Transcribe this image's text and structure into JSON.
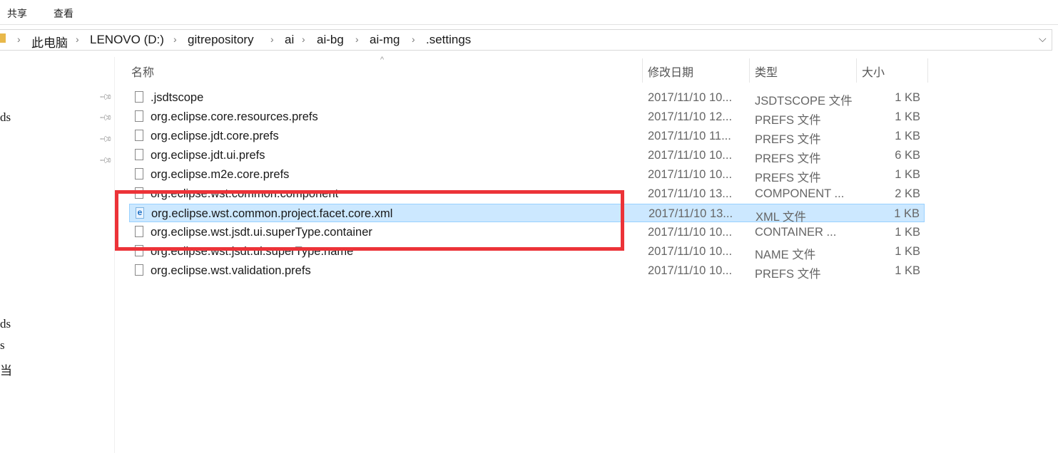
{
  "ribbon": {
    "tabs": [
      "共享",
      "查看"
    ]
  },
  "address_bar": {
    "crumbs": [
      "此电脑",
      "LENOVO (D:)",
      "gitrepository",
      "ai",
      "ai-bg",
      "ai-mg",
      ".settings"
    ]
  },
  "sidebar": {
    "items": [
      "ds",
      "ds",
      "s",
      "当"
    ]
  },
  "columns": {
    "name": "名称",
    "date": "修改日期",
    "type": "类型",
    "size": "大小"
  },
  "files": [
    {
      "name": ".jsdtscope",
      "date": "2017/11/10 10...",
      "type": "JSDTSCOPE 文件",
      "size": "1 KB",
      "icon": "file-icon"
    },
    {
      "name": "org.eclipse.core.resources.prefs",
      "date": "2017/11/10 12...",
      "type": "PREFS 文件",
      "size": "1 KB",
      "icon": "file-icon"
    },
    {
      "name": "org.eclipse.jdt.core.prefs",
      "date": "2017/11/10 11...",
      "type": "PREFS 文件",
      "size": "1 KB",
      "icon": "file-icon"
    },
    {
      "name": "org.eclipse.jdt.ui.prefs",
      "date": "2017/11/10 10...",
      "type": "PREFS 文件",
      "size": "6 KB",
      "icon": "file-icon"
    },
    {
      "name": "org.eclipse.m2e.core.prefs",
      "date": "2017/11/10 10...",
      "type": "PREFS 文件",
      "size": "1 KB",
      "icon": "file-icon"
    },
    {
      "name": "org.eclipse.wst.common.component",
      "date": "2017/11/10 13...",
      "type": "COMPONENT ...",
      "size": "2 KB",
      "icon": "file-icon"
    },
    {
      "name": "org.eclipse.wst.common.project.facet.core.xml",
      "date": "2017/11/10 13...",
      "type": "XML 文件",
      "size": "1 KB",
      "icon": "xml-file-icon",
      "selected": true
    },
    {
      "name": "org.eclipse.wst.jsdt.ui.superType.container",
      "date": "2017/11/10 10...",
      "type": "CONTAINER ...",
      "size": "1 KB",
      "icon": "file-icon"
    },
    {
      "name": "org.eclipse.wst.jsdt.ui.superType.name",
      "date": "2017/11/10 10...",
      "type": "NAME 文件",
      "size": "1 KB",
      "icon": "file-icon"
    },
    {
      "name": "org.eclipse.wst.validation.prefs",
      "date": "2017/11/10 10...",
      "type": "PREFS 文件",
      "size": "1 KB",
      "icon": "file-icon"
    }
  ],
  "colors": {
    "selection": "#cce8ff",
    "highlight_box": "#ec3338"
  }
}
